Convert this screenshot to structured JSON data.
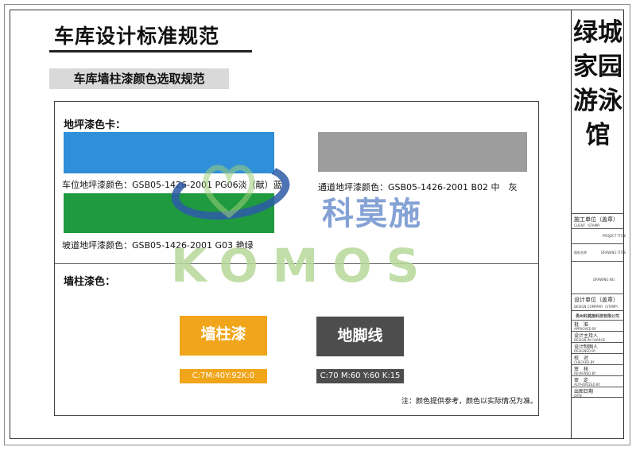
{
  "header": {
    "title": "车库设计标准规范",
    "subtitle": "车库墙柱漆颜色选取规范"
  },
  "floor_section": {
    "heading": "地坪漆色卡：",
    "swatches": [
      {
        "label": "车位地坪漆颜色：GSB05-1426-2001 PG06淡（献）蓝",
        "color": "#2f8fd8"
      },
      {
        "label": "通道地坪漆颜色：GSB05-1426-2001 B02 中　灰",
        "color": "#9d9d9d"
      },
      {
        "label": "坡道地坪漆颜色：GSB05-1426-2001 G03 艳绿",
        "color": "#1f9a3f"
      }
    ]
  },
  "wall_section": {
    "heading": "墙柱漆色：",
    "items": [
      {
        "name": "墙柱漆",
        "code": "C:7M:40Y:92K:0",
        "color": "#f0a51a"
      },
      {
        "name": "地脚线",
        "code": "C:70  M:60 Y:60 K:15",
        "color": "#4d4d4d"
      }
    ],
    "note": "注：颜色提供参考，颜色以实际情况为准。"
  },
  "watermark": {
    "cn": "科莫施",
    "en": "KOMOS"
  },
  "title_block": {
    "project_name": "绿城家园游泳馆",
    "rows": [
      {
        "label": "施工单位（盖章）",
        "sub": "CLIENT（STAMP）"
      },
      {
        "label": "",
        "sub": "PROJECT TITLE"
      },
      {
        "label": "图纸名称",
        "sub": "DRAWING TITLE"
      },
      {
        "label": "",
        "sub": "DRAWING NO."
      },
      {
        "label": "设计单位（盖章）",
        "sub": "DESIGN COMPANY（STAMP）"
      },
      {
        "label": "贵州科莫施科技有限公司",
        "sub": ""
      },
      {
        "label": "批　准",
        "sub": "APPROVED BY"
      },
      {
        "label": "设计主持人",
        "sub": "DESIGN IN CHARGE"
      },
      {
        "label": "设计制图人",
        "sub": "DESIGNED BY"
      },
      {
        "label": "校　对",
        "sub": "CHECKED BY"
      },
      {
        "label": "审　核",
        "sub": "REVIEWED BY"
      },
      {
        "label": "审　定",
        "sub": "AUTHORIZED BY"
      },
      {
        "label": "出图日期",
        "sub": "DATE"
      }
    ]
  },
  "colors": {
    "subtitle_bg": "#d9d9d9",
    "watermark_blue": "#2d5ba8",
    "watermark_green": "#b7d99a"
  }
}
